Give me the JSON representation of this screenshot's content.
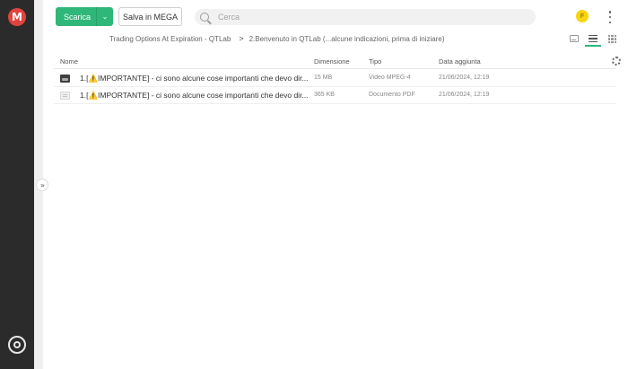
{
  "sidebar": {
    "logo_text": "M",
    "logo_color": "#e0443e",
    "bottom_icon": "transfer-manager-icon"
  },
  "toolbar": {
    "download_label": "Scarica",
    "download_menu_icon": "chevron-down-icon",
    "save_label": "Salva in MEGA",
    "accent_color": "#2fb77a",
    "search_placeholder": "Cerca",
    "avatar_initial": "F"
  },
  "breadcrumb": {
    "parent": "Trading Options At Expiration - QTLab",
    "separator": ">",
    "current": "2.Benvenuto in QTLab (...alcune indicazioni, prima di iniziare)"
  },
  "table": {
    "headers": {
      "name": "Nome",
      "size": "Dimensione",
      "type": "Tipo",
      "date": "Data aggiunta"
    },
    "rows": [
      {
        "icon": "video-file-icon",
        "name": "1.[⚠️IMPORTANTE] - ci sono alcune cose importanti che devo dir...",
        "size": "15 MB",
        "type": "Video MPEG-4",
        "date": "21/06/2024, 12:19"
      },
      {
        "icon": "pdf-file-icon",
        "name": "1.[⚠️IMPORTANTE] - ci sono alcune cose importanti che devo dir...",
        "size": "365 KB",
        "type": "Documento PDF",
        "date": "21/06/2024, 12:19"
      }
    ]
  }
}
